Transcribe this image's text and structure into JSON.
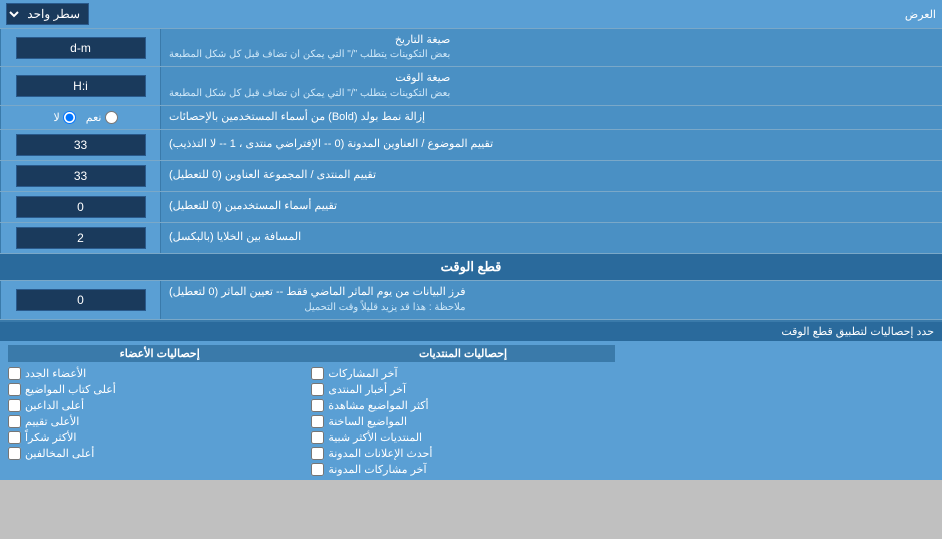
{
  "page": {
    "top": {
      "label": "العرض",
      "select_label": "سطر واحد",
      "select_arrow": "▼"
    },
    "rows": [
      {
        "id": "date-format",
        "label": "صيغة التاريخ",
        "sub_label": "بعض التكوينات يتطلب \"/\" التي يمكن ان تضاف قبل كل شكل المطبعة",
        "value": "d-m"
      },
      {
        "id": "time-format",
        "label": "صيغة الوقت",
        "sub_label": "بعض التكوينات يتطلب \"/\" التي يمكن ان تضاف قبل كل شكل المطبعة",
        "value": "H:i"
      },
      {
        "id": "bold-remove",
        "label": "إزالة نمط بولد (Bold) من أسماء المستخدمين بالإحصائات",
        "radio_yes": "نعم",
        "radio_no": "لا",
        "radio_selected": "no"
      },
      {
        "id": "topic-order",
        "label": "تقييم الموضوع / العناوين المدونة (0 -- الإفتراضي منتدى ، 1 -- لا التذذيب)",
        "value": "33"
      },
      {
        "id": "forum-order",
        "label": "تقييم المنتدى / المجموعة العناوين (0 للتعطيل)",
        "value": "33"
      },
      {
        "id": "user-names",
        "label": "تقييم أسماء المستخدمين (0 للتعطيل)",
        "value": "0"
      },
      {
        "id": "cell-spacing",
        "label": "المسافة بين الخلايا (بالبكسل)",
        "value": "2"
      }
    ],
    "time_cut_section": {
      "header": "قطع الوقت",
      "rows": [
        {
          "id": "time-cut-filter",
          "label": "فرز البيانات من يوم الماثر الماضي فقط -- تعيين الماثر (0 لتعطيل)",
          "sub_label": "ملاحظة : هذا قد يزيد قليلاً وقت التحميل",
          "value": "0"
        }
      ]
    },
    "bottom_section": {
      "header": "حدد إحصاليات لتطبيق قطع الوقت",
      "posts_header": "إحصاليات المنتديات",
      "members_header": "إحصاليات الأعضاء",
      "posts_items": [
        "آخر المشاركات",
        "آخر أخبار المنتدى",
        "أكثر المواضيع مشاهدة",
        "المواضيع الساخنة",
        "المنتديات الأكثر شبية",
        "أحدث الإعلانات المدونة",
        "آخر مشاركات المدونة"
      ],
      "members_items": [
        "الأعضاء الجدد",
        "أعلى كتاب المواضيع",
        "أعلى الداعين",
        "الأعلى تقييم",
        "الأكثر شكراً",
        "أعلى المخالفين"
      ]
    }
  }
}
